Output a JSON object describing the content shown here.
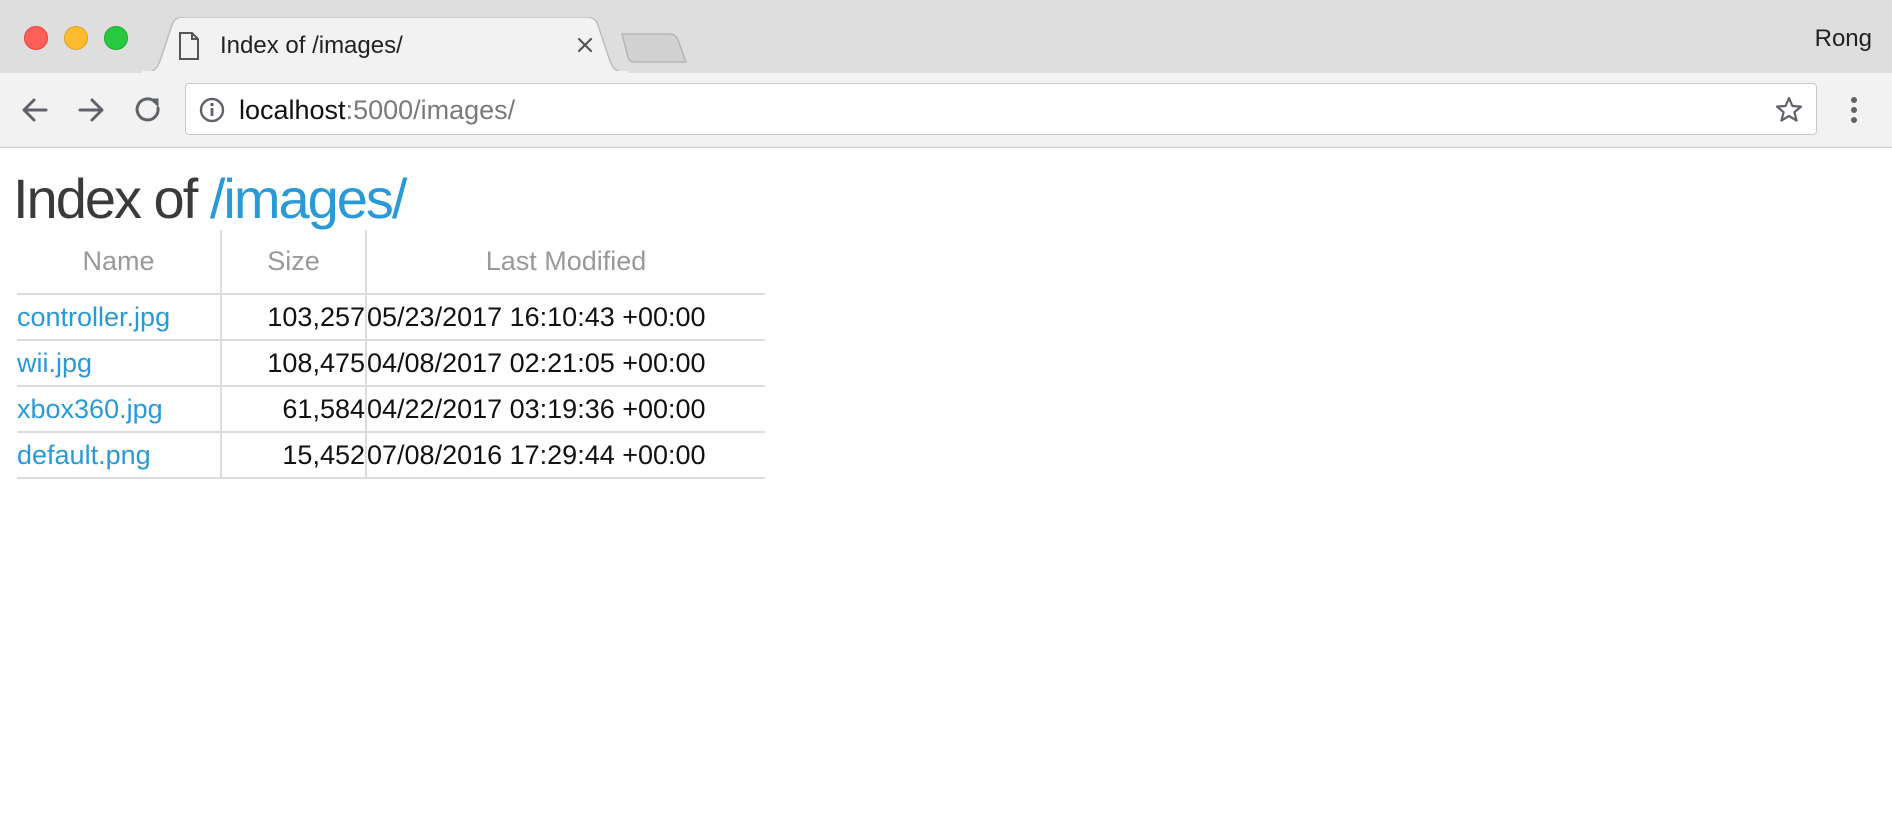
{
  "browser": {
    "tab_title": "Index of /images/",
    "profile_name": "Rong",
    "url_host": "localhost",
    "url_rest": ":5000/images/"
  },
  "page": {
    "heading_prefix": "Index of",
    "heading_path": "/images/",
    "columns": [
      "Name",
      "Size",
      "Last Modified"
    ],
    "files": [
      {
        "name": "controller.jpg",
        "size": "103,257",
        "modified": "05/23/2017 16:10:43 +00:00"
      },
      {
        "name": "wii.jpg",
        "size": "108,475",
        "modified": "04/08/2017 02:21:05 +00:00"
      },
      {
        "name": "xbox360.jpg",
        "size": "61,584",
        "modified": "04/22/2017 03:19:36 +00:00"
      },
      {
        "name": "default.png",
        "size": "15,452",
        "modified": "07/08/2016 17:29:44 +00:00"
      }
    ]
  },
  "colors": {
    "link": "#2a9ad6",
    "header_text": "#999999"
  },
  "icons": [
    "page-icon",
    "close-icon",
    "back-arrow-icon",
    "forward-arrow-icon",
    "reload-icon",
    "info-icon",
    "star-icon",
    "menu-icon"
  ]
}
